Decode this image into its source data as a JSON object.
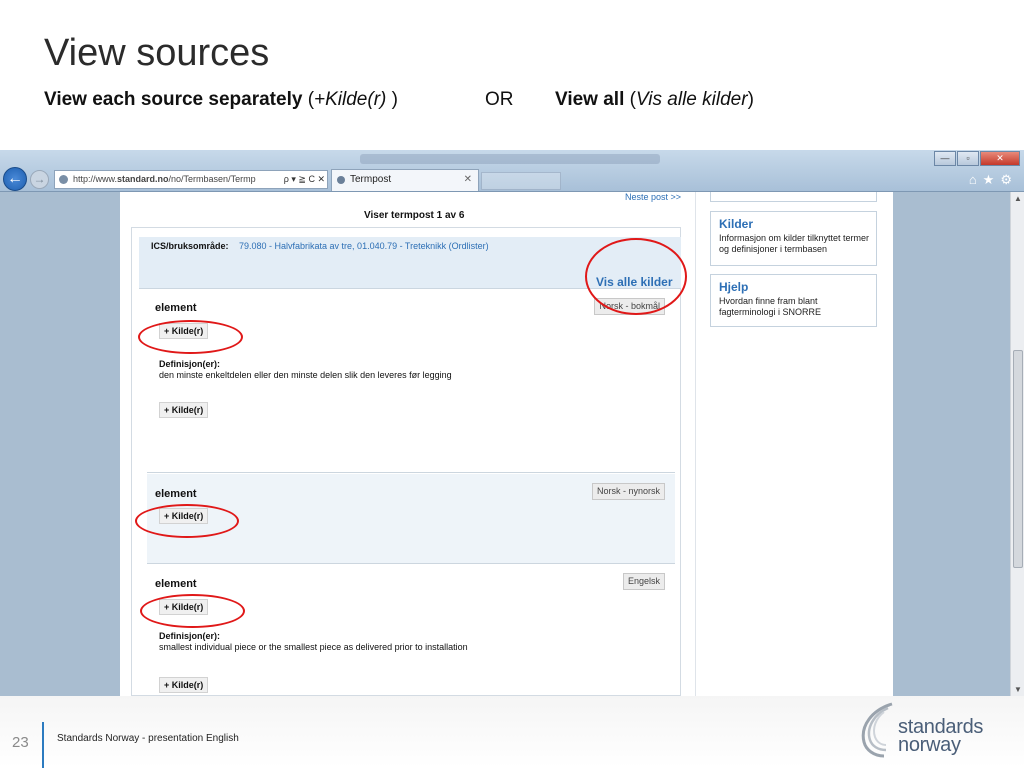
{
  "slide": {
    "title": "View sources",
    "sub_each_bold": "View each source separately",
    "sub_each_paren_open": " (",
    "sub_each_italic": "+Kilde(r)",
    "sub_each_paren_close": " )",
    "sub_or": "OR",
    "sub_all_bold": "View all",
    "sub_all_paren_open": " (",
    "sub_all_italic": "Vis alle kilder",
    "sub_all_paren_close": ")"
  },
  "browser": {
    "back_glyph": "←",
    "forward_glyph": "→",
    "address_prefix": "http://www.",
    "address_domain": "standard.no",
    "address_path": "/no/Termbasen/Termp",
    "address_tools": "ρ ▾ ≧ C ✕",
    "tab_title": "Termpost",
    "tab_close": "✕",
    "window_controls": {
      "minimize": "—",
      "maximize": "▫",
      "close": "✕"
    },
    "right_icons": "⌂★⚙",
    "scroll_up": "▲",
    "scroll_down": "▼"
  },
  "page": {
    "next_link": "Neste post >>",
    "record_counter": "Viser termpost 1 av 6",
    "ics_label": "ICS/bruksområde:",
    "ics_value": "79.080 - Halvfabrikata av tre, 01.040.79 - Treteknikk (Ordlister)",
    "view_all_link": "Vis alle kilder",
    "entries": [
      {
        "label": "element",
        "language": "Norsk - bokmål",
        "kilde": "+ Kilde(r)",
        "definition_heading": "Definisjon(er):",
        "definition": "den minste enkeltdelen eller den minste delen slik den leveres før legging",
        "kilde2": "+ Kilde(r)"
      },
      {
        "label": "element",
        "language": "Norsk - nynorsk",
        "kilde": "+ Kilde(r)"
      },
      {
        "label": "element",
        "language": "Engelsk",
        "kilde": "+ Kilde(r)",
        "definition_heading": "Definisjon(er):",
        "definition": "smallest individual piece or the smallest piece as delivered prior to installation",
        "kilde2": "+ Kilde(r)"
      }
    ],
    "sidebar": [
      {
        "heading": "Kilder",
        "text": "Informasjon om kilder tilknyttet termer og definisjoner i termbasen"
      },
      {
        "heading": "Hjelp",
        "text": "Hvordan finne fram blant fagterminologi i SNORRE"
      }
    ]
  },
  "footer": {
    "page_number": "23",
    "text": "Standards Norway - presentation English",
    "logo_line1": "standards",
    "logo_line2": "norway"
  },
  "colors": {
    "link": "#2d6fb5",
    "highlight_ring": "#e01818",
    "accent_line": "#2c7bc0",
    "logo_text": "#4a5e78"
  }
}
